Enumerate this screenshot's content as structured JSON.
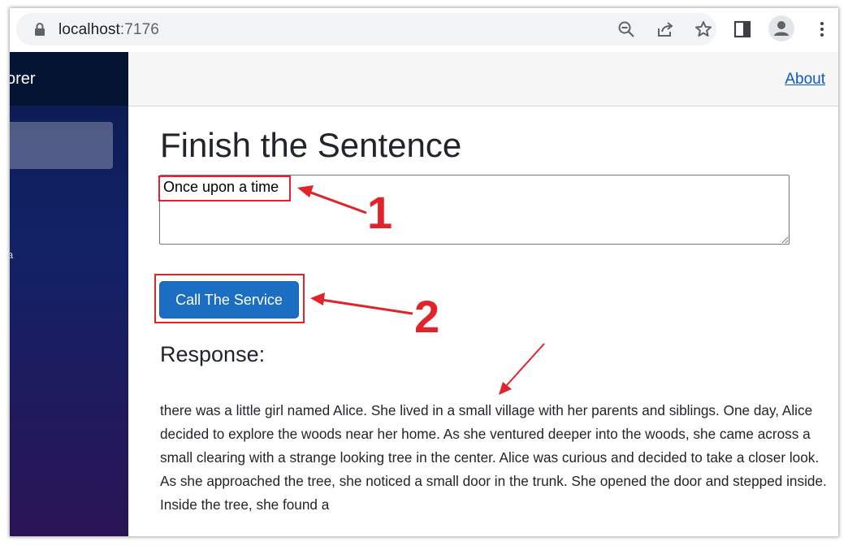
{
  "browser": {
    "url_host": "localhost",
    "url_port": ":7176",
    "icons": [
      "lock-icon",
      "zoom-out-icon",
      "share-icon",
      "bookmark-star-icon",
      "side-panel-icon",
      "profile-icon",
      "menu-icon"
    ]
  },
  "sidebar": {
    "brand_fragment": "orer",
    "item_fragment": "a"
  },
  "topbar": {
    "about_label": "About"
  },
  "main": {
    "title": "Finish the Sentence",
    "prompt_value": "Once upon a time",
    "button_label": "Call The Service",
    "response_heading": "Response:",
    "response_text": "there was a little girl named Alice. She lived in a small village with her parents and siblings. One day, Alice decided to explore the woods near her home. As she ventured deeper into the woods, she came across a small clearing with a strange looking tree in the center. Alice was curious and decided to take a closer look. As she approached the tree, she noticed a small door in the trunk. She opened the door and stepped inside. Inside the tree, she found a"
  },
  "annotations": {
    "step1": "1",
    "step2": "2",
    "color": "#e0242b"
  },
  "colors": {
    "button": "#1b6ec2",
    "link": "#0a58ca",
    "sidebar_top": "#041534"
  }
}
